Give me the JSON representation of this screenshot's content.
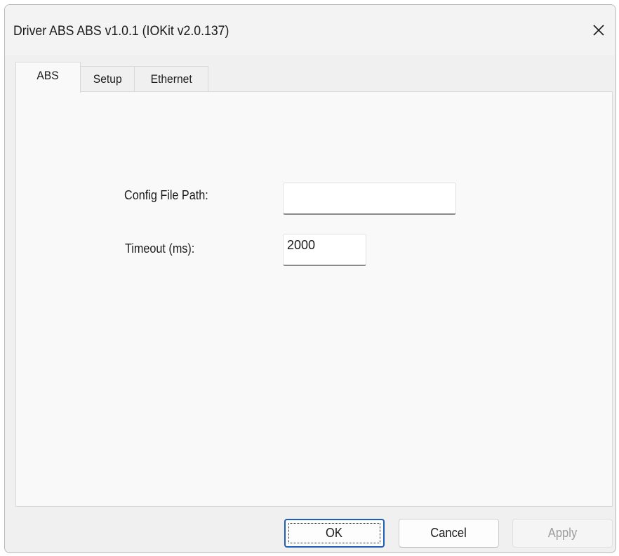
{
  "window": {
    "title": "Driver ABS ABS v1.0.1 (IOKit v2.0.137)",
    "close_glyph": "✕"
  },
  "tabs": [
    {
      "label": "ABS",
      "active": true
    },
    {
      "label": "Setup",
      "active": false
    },
    {
      "label": "Ethernet",
      "active": false
    }
  ],
  "form": {
    "config_path_label": "Config File Path:",
    "config_path_value": "",
    "timeout_label": "Timeout (ms):",
    "timeout_value": "2000"
  },
  "buttons": {
    "ok": "OK",
    "cancel": "Cancel",
    "apply": "Apply"
  },
  "colors": {
    "dialog_bg": "#f0f0f0",
    "panel_bg": "#f9f9f9",
    "default_button_border": "#1f5fb5",
    "disabled_text": "#9d9d9d"
  }
}
